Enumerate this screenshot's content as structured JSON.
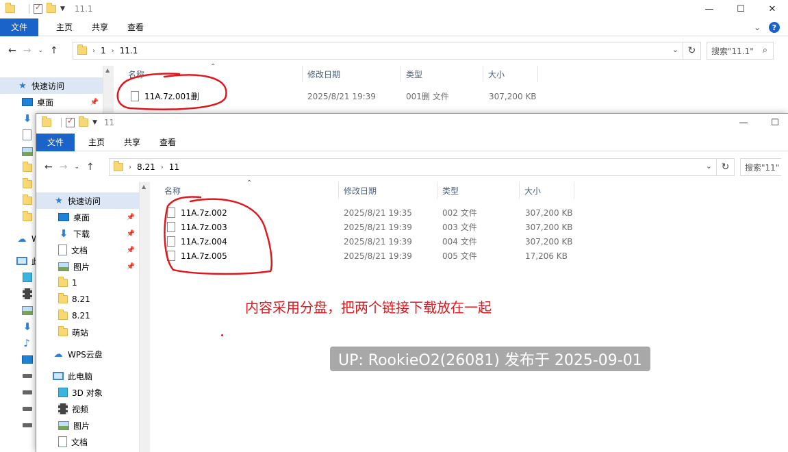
{
  "back": {
    "title": "11.1",
    "tabs": [
      "文件",
      "主页",
      "共享",
      "查看"
    ],
    "breadcrumb": [
      "1",
      "11.1"
    ],
    "search_placeholder": "搜索\"11.1\"",
    "nav": {
      "quick_access": "快速访问",
      "desktop": "桌面",
      "wps": "W",
      "pc": "此"
    },
    "columns": {
      "name": "名称",
      "date": "修改日期",
      "type": "类型",
      "size": "大小"
    },
    "files": [
      {
        "name": "11A.7z.001删",
        "date": "2025/8/21 19:39",
        "type": "001删 文件",
        "size": "307,200 KB"
      }
    ]
  },
  "front": {
    "title": "11",
    "tabs": [
      "文件",
      "主页",
      "共享",
      "查看"
    ],
    "breadcrumb": [
      "8.21",
      "11"
    ],
    "search_placeholder": "搜索\"11\"",
    "nav": [
      {
        "label": "快速访问",
        "icon": "star-icon"
      },
      {
        "label": "桌面",
        "icon": "desktop-icon",
        "pinned": true
      },
      {
        "label": "下载",
        "icon": "download-icon",
        "pinned": true
      },
      {
        "label": "文档",
        "icon": "document-icon",
        "pinned": true
      },
      {
        "label": "图片",
        "icon": "picture-icon",
        "pinned": true
      },
      {
        "label": "1",
        "icon": "folder-icon"
      },
      {
        "label": "8.21",
        "icon": "folder-icon"
      },
      {
        "label": "8.21",
        "icon": "folder-icon"
      },
      {
        "label": "萌站",
        "icon": "folder-icon"
      },
      {
        "label": "WPS云盘",
        "icon": "cloud-icon"
      },
      {
        "label": "此电脑",
        "icon": "computer-icon"
      },
      {
        "label": "3D 对象",
        "icon": "cube-icon"
      },
      {
        "label": "视频",
        "icon": "video-icon"
      },
      {
        "label": "图片",
        "icon": "picture-icon"
      },
      {
        "label": "文档",
        "icon": "document-icon"
      }
    ],
    "columns": {
      "name": "名称",
      "date": "修改日期",
      "type": "类型",
      "size": "大小"
    },
    "files": [
      {
        "name": "11A.7z.002",
        "date": "2025/8/21 19:35",
        "type": "002 文件",
        "size": "307,200 KB"
      },
      {
        "name": "11A.7z.003",
        "date": "2025/8/21 19:39",
        "type": "003 文件",
        "size": "307,200 KB"
      },
      {
        "name": "11A.7z.004",
        "date": "2025/8/21 19:39",
        "type": "004 文件",
        "size": "307,200 KB"
      },
      {
        "name": "11A.7z.005",
        "date": "2025/8/21 19:39",
        "type": "005 文件",
        "size": "17,206 KB"
      }
    ]
  },
  "annotation": "内容采用分盘，把两个链接下载放在一起",
  "watermark": "UP: RookieO2(26081) 发布于 2025-09-01",
  "colors": {
    "accent": "#1a63c8",
    "annotation": "#e0181e",
    "selection": "#dce6f4"
  }
}
